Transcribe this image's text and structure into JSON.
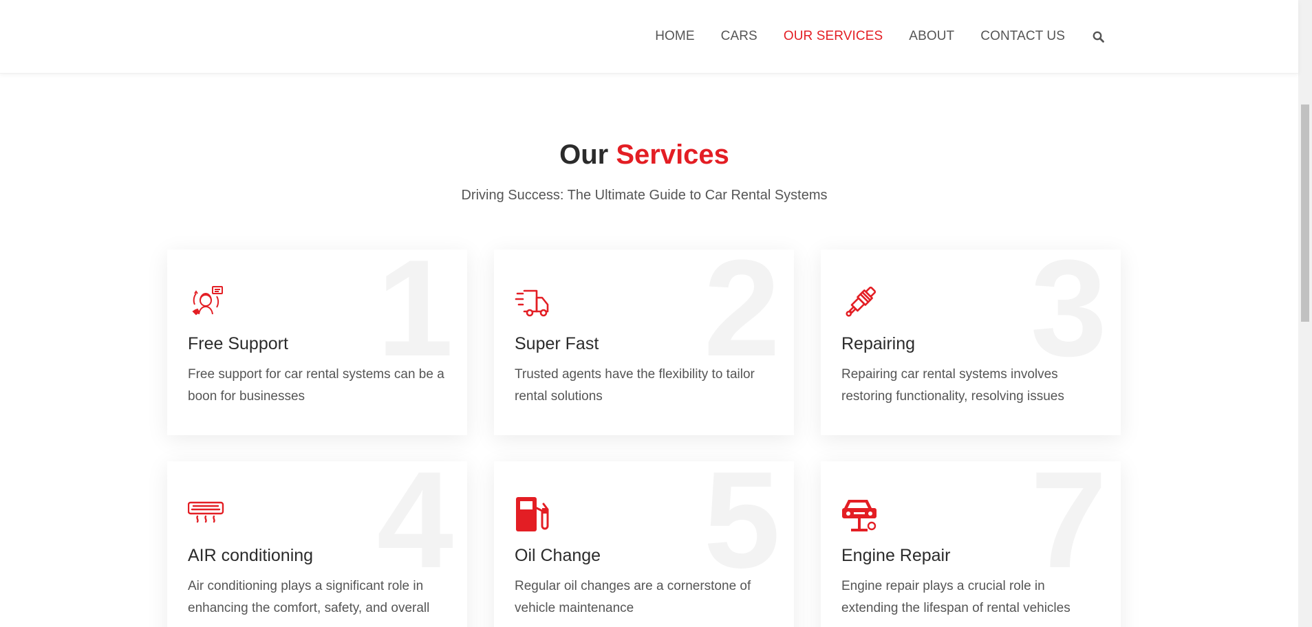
{
  "colors": {
    "accent": "#e31e24",
    "text_dark": "#2b2b2b",
    "text_muted": "#555555"
  },
  "nav": {
    "items": [
      {
        "label": "HOME",
        "active": false
      },
      {
        "label": "CARS",
        "active": false
      },
      {
        "label": "OUR SERVICES",
        "active": true
      },
      {
        "label": "ABOUT",
        "active": false
      },
      {
        "label": "CONTACT US",
        "active": false
      }
    ],
    "search_icon": "search-icon"
  },
  "section": {
    "title_part1": "Our",
    "title_part2": "Services",
    "subtitle": "Driving Success: The Ultimate Guide to Car Rental Systems"
  },
  "services": [
    {
      "number": "1",
      "icon": "support-agent-icon",
      "title": "Free Support",
      "description": "Free support for car rental systems can be a boon for businesses"
    },
    {
      "number": "2",
      "icon": "fast-delivery-truck-icon",
      "title": "Super Fast",
      "description": "Trusted agents have the flexibility to tailor rental solutions"
    },
    {
      "number": "3",
      "icon": "spark-plug-icon",
      "title": "Repairing",
      "description": "Repairing car rental systems involves restoring functionality, resolving issues"
    },
    {
      "number": "4",
      "icon": "air-conditioner-icon",
      "title": "AIR conditioning",
      "description": "Air conditioning plays a significant role in enhancing the comfort, safety, and overall"
    },
    {
      "number": "5",
      "icon": "fuel-pump-icon",
      "title": "Oil Change",
      "description": "Regular oil changes are a cornerstone of vehicle maintenance"
    },
    {
      "number": "7",
      "icon": "car-lift-icon",
      "title": "Engine Repair",
      "description": "Engine repair plays a crucial role in extending the lifespan of rental vehicles"
    }
  ]
}
